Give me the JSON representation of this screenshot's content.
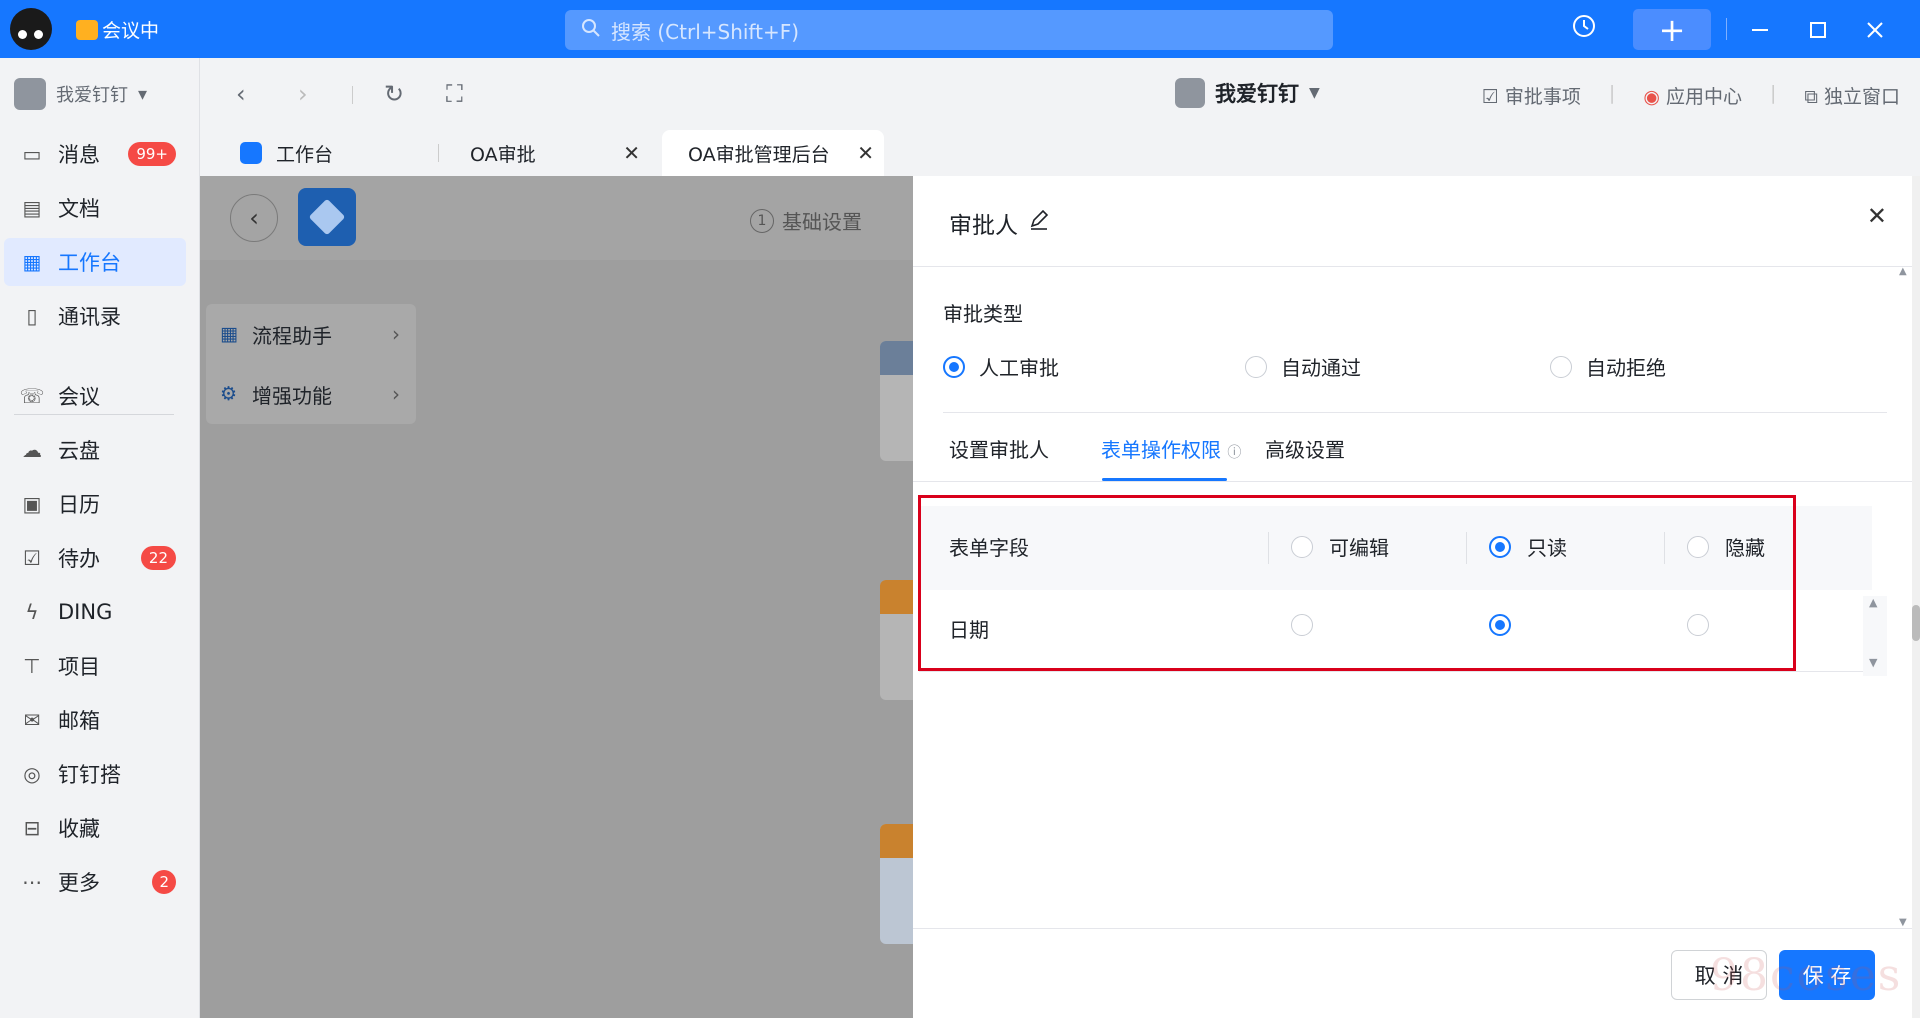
{
  "titlebar": {
    "status": "会议中",
    "search_placeholder": "搜索 (Ctrl+Shift+F)",
    "plus_label": "+",
    "history_icon": "history-icon",
    "colors": {
      "bar": "#1677ff"
    }
  },
  "sidebar": {
    "org_name": "我爱钉钉",
    "items": [
      {
        "label": "消息",
        "icon": "message-icon",
        "badge": "99+"
      },
      {
        "label": "文档",
        "icon": "document-icon",
        "badge": ""
      },
      {
        "label": "工作台",
        "icon": "workbench-icon",
        "badge": "",
        "active": true
      },
      {
        "label": "通讯录",
        "icon": "contacts-icon",
        "badge": ""
      },
      {
        "label": "会议",
        "icon": "meeting-icon",
        "badge": ""
      },
      {
        "label": "云盘",
        "icon": "cloud-icon",
        "badge": ""
      },
      {
        "label": "日历",
        "icon": "calendar-icon",
        "badge": ""
      },
      {
        "label": "待办",
        "icon": "todo-icon",
        "badge": "22"
      },
      {
        "label": "DING",
        "icon": "ding-icon",
        "badge": ""
      },
      {
        "label": "项目",
        "icon": "project-icon",
        "badge": ""
      },
      {
        "label": "邮箱",
        "icon": "mail-icon",
        "badge": ""
      },
      {
        "label": "钉钉搭",
        "icon": "dingda-icon",
        "badge": ""
      },
      {
        "label": "收藏",
        "icon": "favorites-icon",
        "badge": ""
      },
      {
        "label": "更多",
        "icon": "more-icon",
        "badge": "2"
      }
    ]
  },
  "toolbar": {
    "center_title": "我爱钉钉",
    "links": [
      "审批事项",
      "应用中心",
      "独立窗口"
    ]
  },
  "tabs": [
    {
      "label": "工作台",
      "closable": false
    },
    {
      "label": "OA审批",
      "closable": true
    },
    {
      "label": "OA审批管理后台",
      "closable": true,
      "active": true
    }
  ],
  "background": {
    "step_number": "1",
    "step_label": "基础设置",
    "menu": [
      {
        "label": "流程助手",
        "icon": "flow-icon"
      },
      {
        "label": "增强功能",
        "icon": "enhance-icon"
      }
    ]
  },
  "panel": {
    "title": "审批人",
    "section_label": "审批类型",
    "approval_types": [
      {
        "label": "人工审批",
        "checked": true
      },
      {
        "label": "自动通过",
        "checked": false
      },
      {
        "label": "自动拒绝",
        "checked": false
      }
    ],
    "tabs": [
      "设置审批人",
      "表单操作权限",
      "高级设置"
    ],
    "active_tab": "表单操作权限",
    "table": {
      "columns": [
        "表单字段",
        "可编辑",
        "只读",
        "隐藏"
      ],
      "header_selected": "只读",
      "rows": [
        {
          "field": "日期",
          "selected": "只读"
        }
      ]
    },
    "cancel_label": "取 消",
    "save_label": "保 存"
  },
  "watermark": "98coses"
}
